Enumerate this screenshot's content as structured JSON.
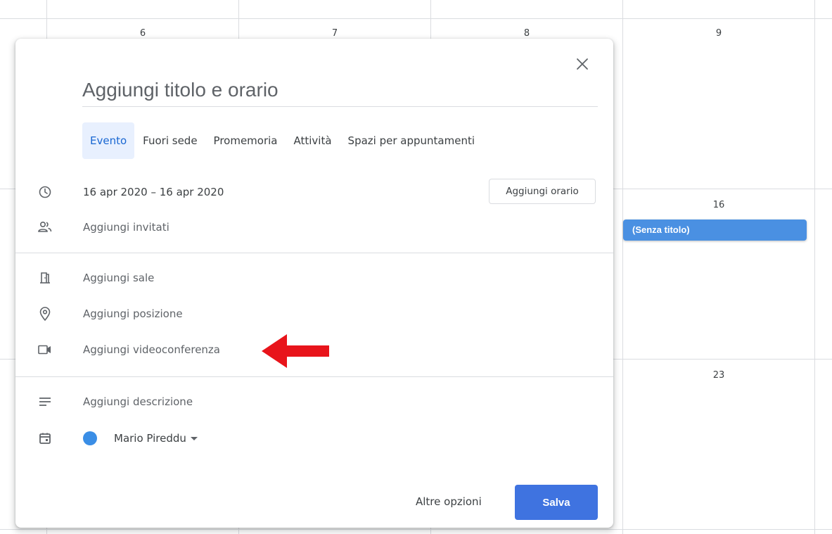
{
  "calendar": {
    "day_numbers": {
      "d6": "6",
      "d7": "7",
      "d8": "8",
      "d9": "9",
      "d16": "16",
      "d23": "23"
    },
    "event_label": "(Senza titolo)",
    "event_color": "#4a90e2"
  },
  "dialog": {
    "close_icon": "close-icon",
    "title_placeholder": "Aggiungi titolo e orario",
    "tabs": [
      {
        "label": "Evento",
        "active": true
      },
      {
        "label": "Fuori sede",
        "active": false
      },
      {
        "label": "Promemoria",
        "active": false
      },
      {
        "label": "Attività",
        "active": false
      },
      {
        "label": "Spazi per appuntamenti",
        "active": false
      }
    ],
    "date_range": "16 apr 2020  –  16 apr 2020",
    "add_time_label": "Aggiungi orario",
    "guests_label": "Aggiungi invitati",
    "rooms_label": "Aggiungi sale",
    "location_label": "Aggiungi posizione",
    "video_label": "Aggiungi videoconferenza",
    "description_label": "Aggiungi descrizione",
    "calendar_owner": "Mario Pireddu",
    "owner_color": "#3a8ee6",
    "more_options_label": "Altre opzioni",
    "save_label": "Salva",
    "accent_color": "#3f73e0",
    "annotation_arrow_color": "#e8141b"
  }
}
